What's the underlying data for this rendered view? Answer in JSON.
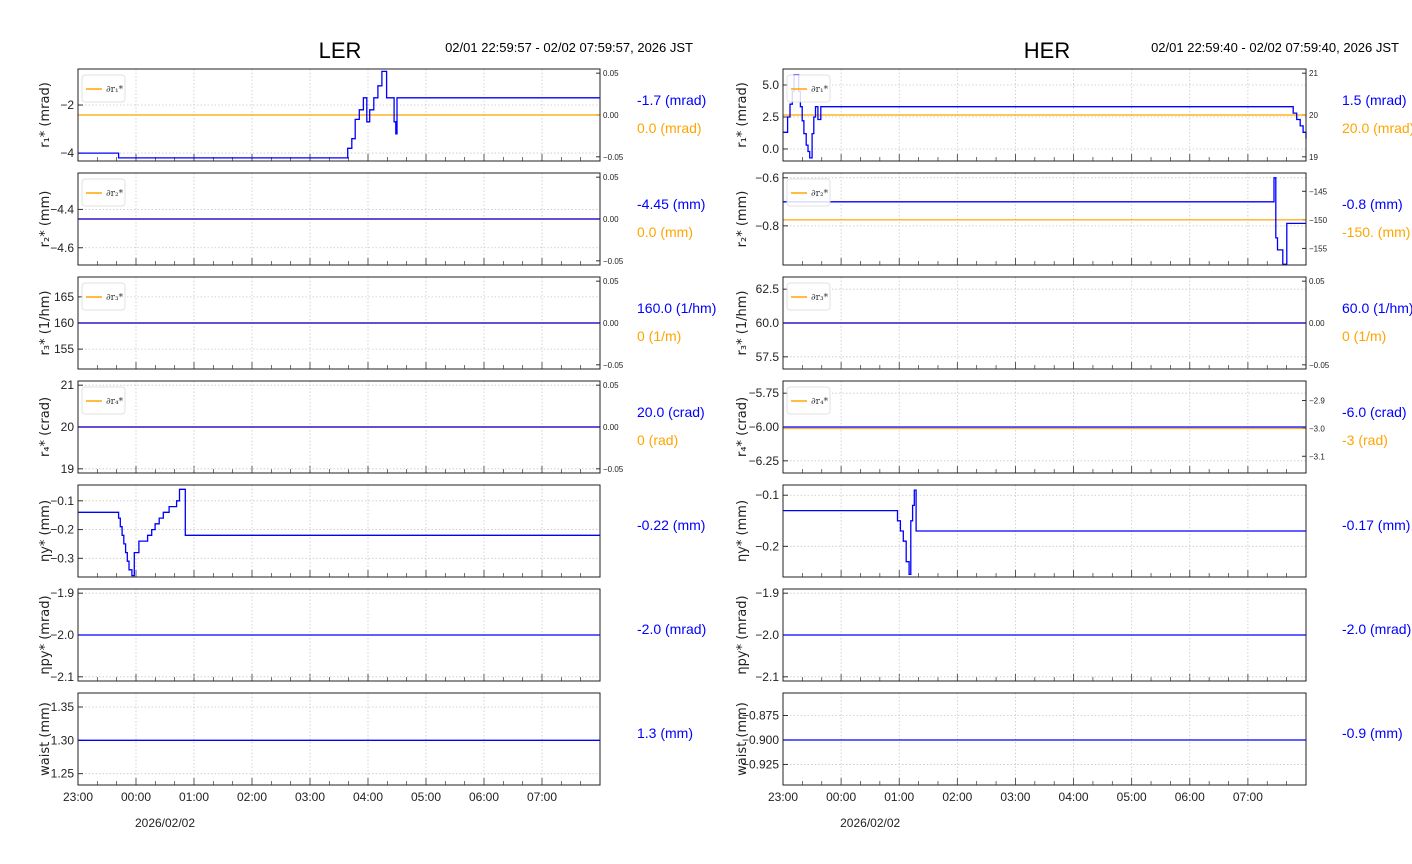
{
  "colors": {
    "primary": "#0000ff",
    "reference": "#ffa500",
    "grid": "#c8c8c8"
  },
  "chart_data": [
    {
      "type": "line",
      "title": "LER",
      "time_range": "02/01 22:59:57 - 02/02 07:59:57, 2026 JST",
      "x_unit": "hours since 23:00",
      "xlim": [
        0,
        9
      ],
      "x_ticks": [
        "23:00",
        "00:00",
        "01:00",
        "02:00",
        "03:00",
        "04:00",
        "05:00",
        "06:00",
        "07:00"
      ],
      "date_label": "2026/02/02",
      "panels": [
        {
          "ylabel": "r₁* (mrad)",
          "ylim": [
            -4.33,
            -0.5
          ],
          "yticks": [
            -2,
            -4
          ],
          "ytick_labels": [
            "−2",
            "−4"
          ],
          "legend": "∂r₁*",
          "ref_ylim": [
            -0.055,
            0.055
          ],
          "ref_ticks": [
            0.05,
            0.0,
            -0.05
          ],
          "ref_tick_labels": [
            "0.05",
            "0.00",
            "−0.05"
          ],
          "ref_value": 0.0,
          "value_label": "-1.7 (mrad)",
          "ref_label": "0.0 (mrad)",
          "series": [
            [
              0,
              -4.0
            ],
            [
              0.7,
              -4.2
            ],
            [
              4.65,
              -3.8
            ],
            [
              4.72,
              -3.4
            ],
            [
              4.78,
              -2.6
            ],
            [
              4.85,
              -2.2
            ],
            [
              4.92,
              -1.7
            ],
            [
              4.98,
              -2.7
            ],
            [
              5.03,
              -2.2
            ],
            [
              5.1,
              -1.7
            ],
            [
              5.17,
              -1.2
            ],
            [
              5.24,
              -0.6
            ],
            [
              5.32,
              -1.7
            ],
            [
              5.45,
              -2.7
            ],
            [
              5.48,
              -3.2
            ],
            [
              5.5,
              -1.7
            ],
            [
              9,
              -1.7
            ]
          ]
        },
        {
          "ylabel": "r₂* (mm)",
          "ylim": [
            -4.69,
            -4.21
          ],
          "yticks": [
            -4.4,
            -4.6
          ],
          "ytick_labels": [
            "−4.4",
            "−4.6"
          ],
          "legend": "∂r₂*",
          "ref_ylim": [
            -0.055,
            0.055
          ],
          "ref_ticks": [
            0.05,
            0.0,
            -0.05
          ],
          "ref_tick_labels": [
            "0.05",
            "0.00",
            "−0.05"
          ],
          "ref_value": 0.0,
          "value_label": "-4.45 (mm)",
          "ref_label": "0.0 (mm)",
          "series": [
            [
              0,
              -4.45
            ],
            [
              9,
              -4.45
            ]
          ]
        },
        {
          "ylabel": "r₃* (1/hm)",
          "ylim": [
            151.2,
            168.8
          ],
          "yticks": [
            165,
            160,
            155
          ],
          "ytick_labels": [
            "165",
            "160",
            "155"
          ],
          "legend": "∂r₃*",
          "ref_ylim": [
            -0.055,
            0.055
          ],
          "ref_ticks": [
            0.05,
            0.0,
            -0.05
          ],
          "ref_tick_labels": [
            "0.05",
            "0.00",
            "−0.05"
          ],
          "ref_value": 0.0,
          "value_label": "160.0 (1/hm)",
          "ref_label": "0 (1/m)",
          "series": [
            [
              0,
              160
            ],
            [
              9,
              160
            ]
          ]
        },
        {
          "ylabel": "r₄* (crad)",
          "ylim": [
            18.9,
            21.1
          ],
          "yticks": [
            21,
            20,
            19
          ],
          "ytick_labels": [
            "21",
            "20",
            "19"
          ],
          "legend": "∂r₄*",
          "ref_ylim": [
            -0.055,
            0.055
          ],
          "ref_ticks": [
            0.05,
            0.0,
            -0.05
          ],
          "ref_tick_labels": [
            "0.05",
            "0.00",
            "−0.05"
          ],
          "ref_value": 0.0,
          "value_label": "20.0 (crad)",
          "ref_label": "0 (rad)",
          "series": [
            [
              0,
              20
            ],
            [
              9,
              20
            ]
          ]
        },
        {
          "ylabel": "ηy* (mm)",
          "ylim": [
            -0.365,
            -0.045
          ],
          "yticks": [
            -0.1,
            -0.2,
            -0.3
          ],
          "ytick_labels": [
            "−0.1",
            "−0.2",
            "−0.3"
          ],
          "value_label": "-0.22 (mm)",
          "series": [
            [
              0,
              -0.14
            ],
            [
              0.7,
              -0.16
            ],
            [
              0.73,
              -0.19
            ],
            [
              0.76,
              -0.22
            ],
            [
              0.79,
              -0.25
            ],
            [
              0.82,
              -0.28
            ],
            [
              0.85,
              -0.31
            ],
            [
              0.88,
              -0.34
            ],
            [
              0.93,
              -0.36
            ],
            [
              0.97,
              -0.28
            ],
            [
              1.05,
              -0.24
            ],
            [
              1.2,
              -0.22
            ],
            [
              1.27,
              -0.2
            ],
            [
              1.33,
              -0.18
            ],
            [
              1.4,
              -0.16
            ],
            [
              1.47,
              -0.14
            ],
            [
              1.57,
              -0.12
            ],
            [
              1.7,
              -0.1
            ],
            [
              1.75,
              -0.06
            ],
            [
              1.85,
              -0.22
            ],
            [
              9,
              -0.22
            ]
          ]
        },
        {
          "ylabel": "ηpy* (mrad)",
          "ylim": [
            -2.11,
            -1.89
          ],
          "yticks": [
            -1.9,
            -2.0,
            -2.1
          ],
          "ytick_labels": [
            "−1.9",
            "−2.0",
            "−2.1"
          ],
          "value_label": "-2.0 (mrad)",
          "series": [
            [
              0,
              -2.0
            ],
            [
              9,
              -2.0
            ]
          ]
        },
        {
          "ylabel": "waist (mm)",
          "ylim": [
            1.233,
            1.371
          ],
          "yticks": [
            1.35,
            1.3,
            1.25
          ],
          "ytick_labels": [
            "1.35",
            "1.30",
            "1.25"
          ],
          "value_label": "1.3 (mm)",
          "series": [
            [
              0,
              1.3
            ],
            [
              9,
              1.3
            ]
          ]
        }
      ]
    },
    {
      "type": "line",
      "title": "HER",
      "time_range": "02/01 22:59:40 - 02/02 07:59:40, 2026 JST",
      "x_unit": "hours since 23:00",
      "xlim": [
        0,
        9
      ],
      "x_ticks": [
        "23:00",
        "00:00",
        "01:00",
        "02:00",
        "03:00",
        "04:00",
        "05:00",
        "06:00",
        "07:00"
      ],
      "date_label": "2026/02/02",
      "panels": [
        {
          "ylabel": "r₁* (mrad)",
          "ylim": [
            -0.94,
            6.25
          ],
          "yticks": [
            5.0,
            2.5,
            0.0
          ],
          "ytick_labels": [
            "5.0",
            "2.5",
            "0.0"
          ],
          "legend": "∂r₁*",
          "ref_ylim": [
            18.9,
            21.1
          ],
          "ref_ticks": [
            21,
            20,
            19
          ],
          "ref_tick_labels": [
            "21",
            "20",
            "19"
          ],
          "ref_value": 20.0,
          "value_label": "1.5 (mrad)",
          "ref_label": "20.0 (mrad)",
          "series": [
            [
              0,
              1.3
            ],
            [
              0.08,
              2.5
            ],
            [
              0.12,
              3.5
            ],
            [
              0.16,
              4.5
            ],
            [
              0.19,
              5.8
            ],
            [
              0.27,
              4.5
            ],
            [
              0.3,
              3.3
            ],
            [
              0.33,
              2.2
            ],
            [
              0.36,
              1.2
            ],
            [
              0.4,
              0.3
            ],
            [
              0.43,
              -0.2
            ],
            [
              0.46,
              -0.7
            ],
            [
              0.5,
              1.2
            ],
            [
              0.53,
              2.5
            ],
            [
              0.56,
              3.3
            ],
            [
              0.6,
              2.3
            ],
            [
              0.65,
              3.3
            ],
            [
              8.72,
              3.3
            ],
            [
              8.78,
              2.8
            ],
            [
              8.84,
              2.3
            ],
            [
              8.9,
              1.8
            ],
            [
              8.95,
              1.3
            ],
            [
              9.0,
              0.8
            ]
          ]
        },
        {
          "ylabel": "r₂* (mm)",
          "ylim": [
            -0.963,
            -0.58
          ],
          "yticks": [
            -0.6,
            -0.8
          ],
          "ytick_labels": [
            "−0.6",
            "−0.8"
          ],
          "legend": "∂r₂*",
          "ref_ylim": [
            -157.9,
            -141.8
          ],
          "ref_ticks": [
            -145,
            -150,
            -155
          ],
          "ref_tick_labels": [
            "−145",
            "−150",
            "−155"
          ],
          "ref_value": -150,
          "value_label": "-0.8 (mm)",
          "ref_label": "-150. (mm)",
          "series": [
            [
              0,
              -0.7
            ],
            [
              8.45,
              -0.6
            ],
            [
              8.48,
              -0.85
            ],
            [
              8.51,
              -0.9
            ],
            [
              8.6,
              -0.96
            ],
            [
              8.67,
              -0.79
            ],
            [
              9,
              -0.79
            ]
          ]
        },
        {
          "ylabel": "r₃* (1/hm)",
          "ylim": [
            56.6,
            63.4
          ],
          "yticks": [
            62.5,
            60.0,
            57.5
          ],
          "ytick_labels": [
            "62.5",
            "60.0",
            "57.5"
          ],
          "legend": "∂r₃*",
          "ref_ylim": [
            -0.055,
            0.055
          ],
          "ref_ticks": [
            0.05,
            0.0,
            -0.05
          ],
          "ref_tick_labels": [
            "0.05",
            "0.00",
            "−0.05"
          ],
          "ref_value": 0.0,
          "value_label": "60.0 (1/hm)",
          "ref_label": "0 (1/m)",
          "series": [
            [
              0,
              60
            ],
            [
              9,
              60
            ]
          ]
        },
        {
          "ylabel": "r₄* (crad)",
          "ylim": [
            -6.34,
            -5.66
          ],
          "yticks": [
            -5.75,
            -6.0,
            -6.25
          ],
          "ytick_labels": [
            "−5.75",
            "−6.00",
            "−6.25"
          ],
          "legend": "∂r₄*",
          "ref_ylim": [
            -3.16,
            -2.83
          ],
          "ref_ticks": [
            -2.9,
            -3.0,
            -3.1
          ],
          "ref_tick_labels": [
            "−2.9",
            "−3.0",
            "−3.1"
          ],
          "ref_value": -3.0,
          "value_label": "-6.0 (crad)",
          "ref_label": "-3 (rad)",
          "series": [
            [
              0,
              -6.0
            ],
            [
              9,
              -6.0
            ]
          ]
        },
        {
          "ylabel": "ηy* (mm)",
          "ylim": [
            -0.26,
            -0.08
          ],
          "yticks": [
            -0.1,
            -0.2
          ],
          "ytick_labels": [
            "−0.1",
            "−0.2"
          ],
          "value_label": "-0.17 (mm)",
          "series": [
            [
              0,
              -0.13
            ],
            [
              1.97,
              -0.15
            ],
            [
              2.02,
              -0.17
            ],
            [
              2.07,
              -0.19
            ],
            [
              2.12,
              -0.23
            ],
            [
              2.17,
              -0.255
            ],
            [
              2.2,
              -0.15
            ],
            [
              2.23,
              -0.12
            ],
            [
              2.26,
              -0.09
            ],
            [
              2.29,
              -0.17
            ],
            [
              9,
              -0.17
            ]
          ]
        },
        {
          "ylabel": "ηpy* (mrad)",
          "ylim": [
            -2.11,
            -1.89
          ],
          "yticks": [
            -1.9,
            -2.0,
            -2.1
          ],
          "ytick_labels": [
            "−1.9",
            "−2.0",
            "−2.1"
          ],
          "value_label": "-2.0 (mrad)",
          "series": [
            [
              0,
              -2.0
            ],
            [
              9,
              -2.0
            ]
          ]
        },
        {
          "ylabel": "waist (mm)",
          "ylim": [
            -0.946,
            -0.852
          ],
          "yticks": [
            -0.875,
            -0.9,
            -0.925
          ],
          "ytick_labels": [
            "−0.875",
            "−0.900",
            "−0.925"
          ],
          "value_label": "-0.9 (mm)",
          "series": [
            [
              0,
              -0.9
            ],
            [
              9,
              -0.9
            ]
          ]
        }
      ]
    }
  ]
}
